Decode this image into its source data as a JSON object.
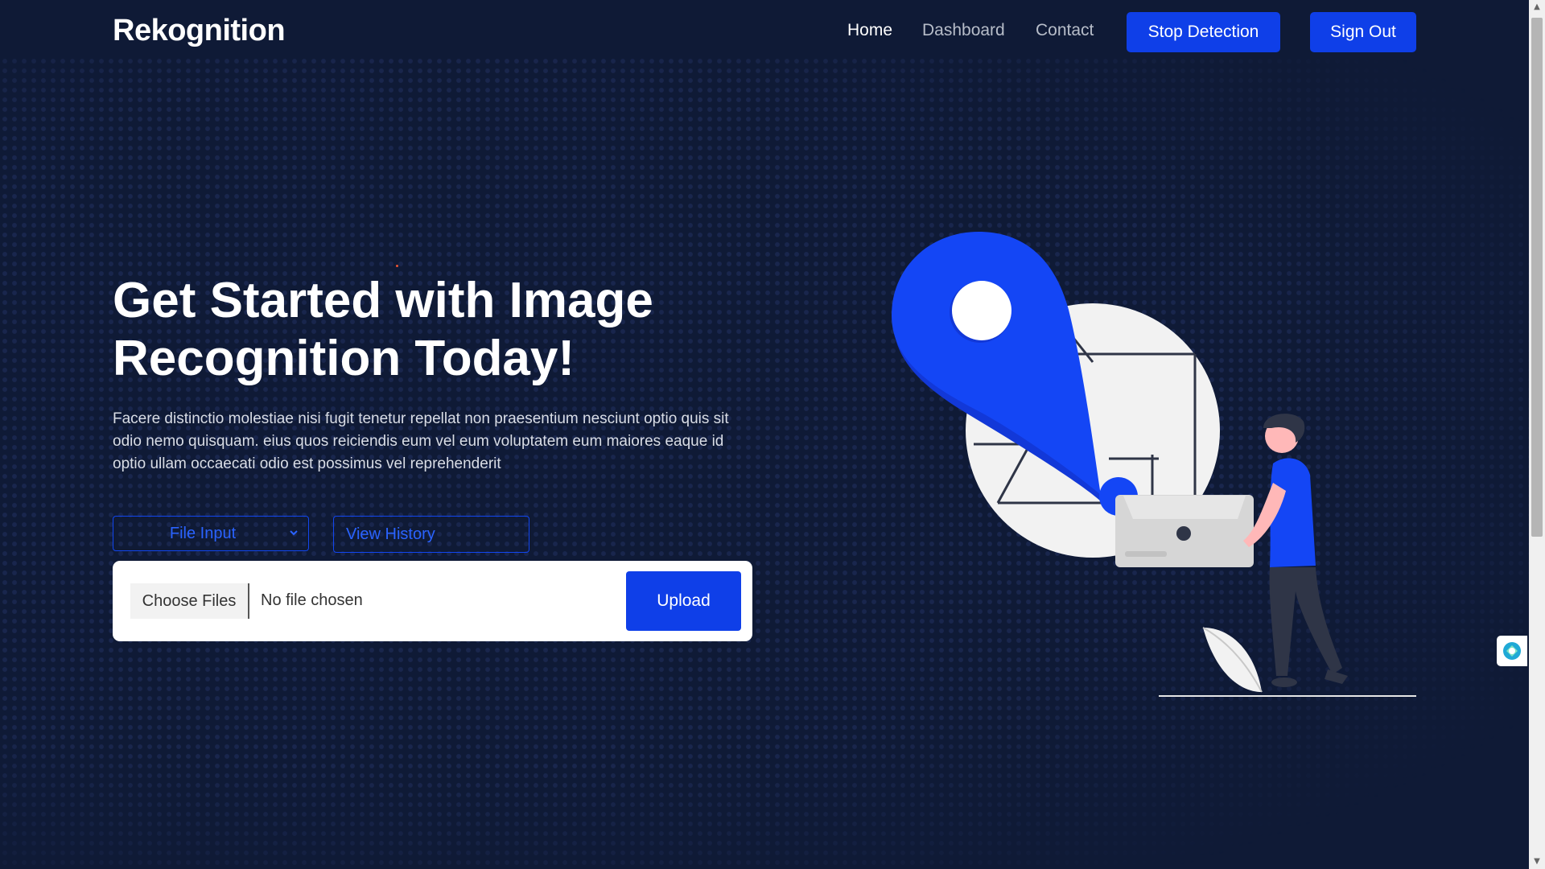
{
  "header": {
    "logo": "Rekognition",
    "nav": [
      {
        "label": "Home",
        "active": true
      },
      {
        "label": "Dashboard",
        "active": false
      },
      {
        "label": "Contact",
        "active": false
      }
    ],
    "stop_detection_label": "Stop Detection",
    "sign_out_label": "Sign Out"
  },
  "hero": {
    "title": "Get Started with Image Recognition Today!",
    "description": "Facere distinctio molestiae nisi fugit tenetur repellat non praesentium nesciunt optio quis sit odio nemo quisquam. eius quos reiciendis eum vel eum voluptatem eum maiores eaque id optio ullam occaecati odio est possimus vel reprehenderit"
  },
  "controls": {
    "input_mode_selected": "File Input",
    "view_history_label": "View History",
    "choose_files_label": "Choose Files",
    "file_status": "No file chosen",
    "upload_label": "Upload"
  },
  "colors": {
    "background": "#0f1a36",
    "primary": "#0f3fe8",
    "accent_text": "#2a63ff"
  },
  "icons": {
    "select_chevron": "chevron-down-icon",
    "side_widget": "assistant-icon"
  }
}
